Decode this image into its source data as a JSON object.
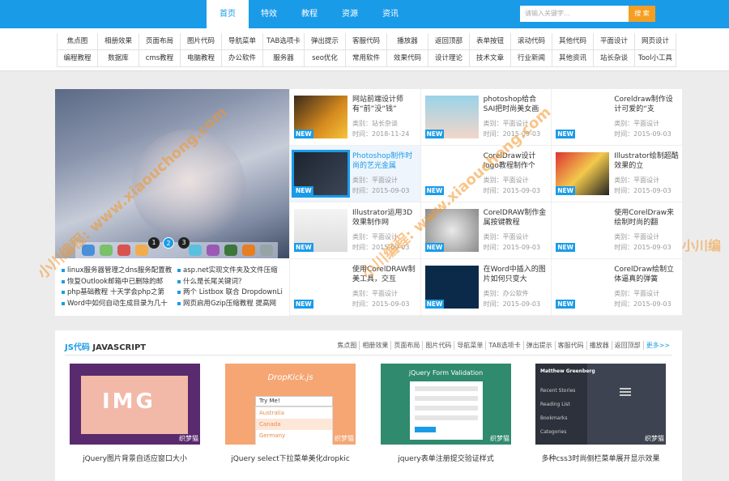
{
  "nav": {
    "items": [
      "首页",
      "特效",
      "教程",
      "资源",
      "资讯"
    ]
  },
  "search": {
    "placeholder": "请输入关键字...",
    "button": "搜 索"
  },
  "categories": [
    "焦点图",
    "相册效果",
    "页面布局",
    "图片代码",
    "导航菜单",
    "TAB选项卡",
    "弹出提示",
    "客服代码",
    "播放器",
    "返回顶部",
    "表单按钮",
    "滚动代码",
    "其他代码",
    "平面设计",
    "网页设计",
    "编程教程",
    "数据库",
    "cms教程",
    "电脑教程",
    "办公软件",
    "服务器",
    "seo优化",
    "常用软件",
    "效果代码",
    "设计理论",
    "技术文章",
    "行业新闻",
    "其他资讯",
    "站长杂谈",
    "Tool小工具"
  ],
  "slider": {
    "dots": [
      "1",
      "2",
      "3"
    ],
    "active": 1
  },
  "news_left": [
    "linux服务器管理之dns服务配置教",
    "恢复Outlook邮箱中已删除的邮",
    "php基础教程 十天学会php之第",
    "Word中如何自动生成目录为几十"
  ],
  "news_right": [
    "asp.net实现文件夹及文件压缩",
    "什么是长尾关键词？",
    "两个 Listbox 联合 DropdownLi",
    "网页启用Gzip压缩教程 提高网"
  ],
  "tiles": [
    {
      "title": "网站前端设计师有“前”没“钱”",
      "category": "类别：站长杂谈",
      "date": "时间：2018-11-24",
      "tag": "NEW"
    },
    {
      "title": "photoshop给合SAI把时尚美女画",
      "category": "类别：平面设计",
      "date": "时间：2015-09-03",
      "tag": "NEW"
    },
    {
      "title": "Coreldraw制作设计可爱的“支",
      "category": "类别：平面设计",
      "date": "时间：2015-09-03",
      "tag": "NEW"
    },
    {
      "title": "Photoshop制作时尚的艺光金属",
      "category": "类别：平面设计",
      "date": "时间：2015-09-03",
      "tag": "NEW"
    },
    {
      "title": "CorelDraw设计logo教程制作个",
      "category": "类别：平面设计",
      "date": "时间：2015-09-03",
      "tag": "NEW"
    },
    {
      "title": "Illustrator绘制超酷效果的立",
      "category": "类别：平面设计",
      "date": "时间：2015-09-03",
      "tag": "NEW"
    },
    {
      "title": "Illustrator运用3D效果制作网",
      "category": "类别：平面设计",
      "date": "时间：2015-09-03",
      "tag": "NEW"
    },
    {
      "title": "CorelDRAW制作金属按键教程",
      "category": "类别：平面设计",
      "date": "时间：2015-09-03",
      "tag": "NEW"
    },
    {
      "title": "使用CorelDraw来绘制时尚的翻",
      "category": "类别：平面设计",
      "date": "时间：2015-09-03",
      "tag": "NEW"
    },
    {
      "title": "使用CorelDRAW制美工具，交互",
      "category": "类别：平面设计",
      "date": "时间：2015-09-03",
      "tag": "NEW"
    },
    {
      "title": "在Word中插入的图片如何只变大",
      "category": "类别：办公软件",
      "date": "时间：2015-09-03",
      "tag": "NEW"
    },
    {
      "title": "CorelDraw绘制立体逼真的弹簧",
      "category": "类别：平面设计",
      "date": "时间：2015-09-03",
      "tag": "NEW"
    }
  ],
  "section": {
    "title_cn": "JS代码",
    "title_en": "JAVASCRIPT",
    "links": [
      "焦点图",
      "相册效果",
      "页面布局",
      "图片代码",
      "导航菜单",
      "TAB选项卡",
      "弹出提示",
      "客服代码",
      "播放器",
      "返回顶部"
    ],
    "more": "更多>>",
    "cards": [
      {
        "caption": "jQuery图片背景自适应窗口大小",
        "label": "IMG",
        "badge": "织梦猫"
      },
      {
        "caption": "jQuery select下拉菜单美化dropkic",
        "label": "DropKick.js",
        "badge": "织梦猫",
        "select": "Try Me!",
        "options": [
          "Australia",
          "Canada",
          "Germany"
        ]
      },
      {
        "caption": "jquery表单注册提交验证样式",
        "label": "jQuery Form Validation",
        "badge": "织梦猫"
      },
      {
        "caption": "多种css3时尚侧栏菜单展开显示效果",
        "label": "Matthew Greenberg",
        "badge": "织梦猫",
        "menu": [
          "Recent Stories",
          "Reading List",
          "Bookmarks",
          "Categories"
        ]
      }
    ]
  },
  "watermark": {
    "left": "小川编程: www.xiaouchong.com",
    "right": "小川编程: www.xiaouchong.com",
    "side": "小川编"
  },
  "colors": {
    "brand": "#1a9be8",
    "accent": "#f49f22"
  }
}
